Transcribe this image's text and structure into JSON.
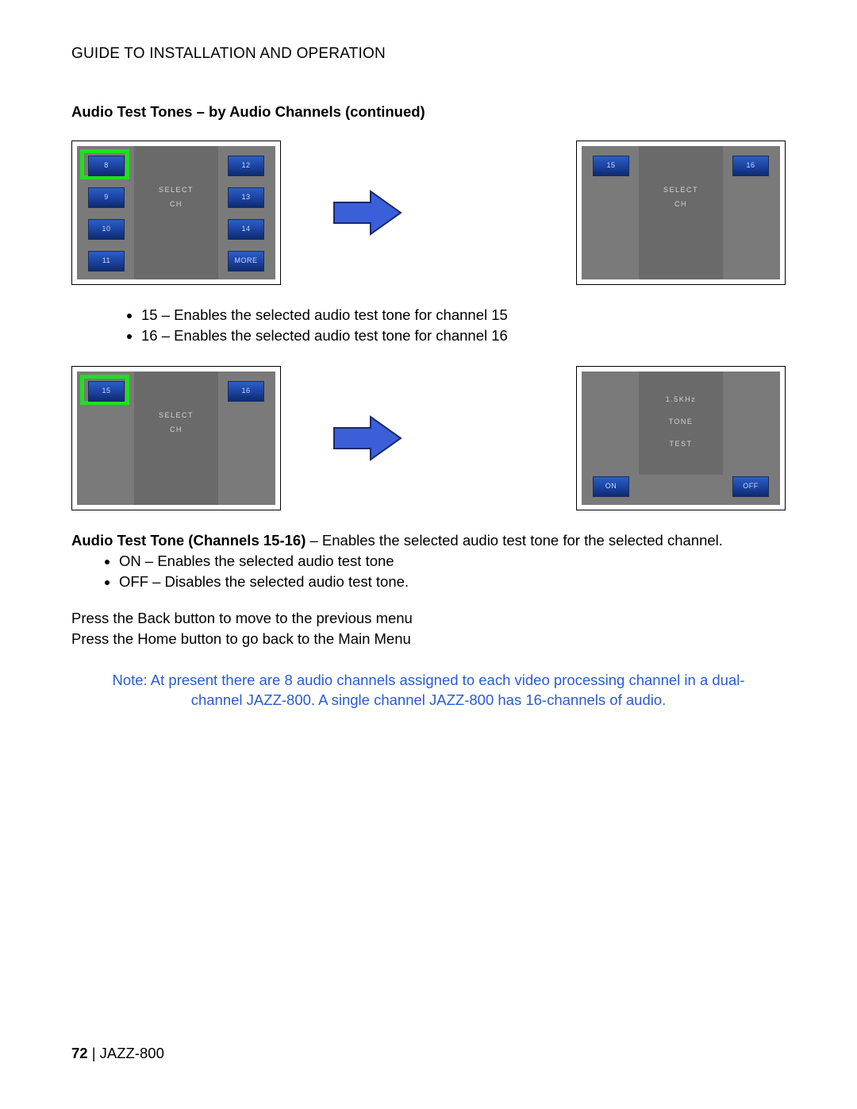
{
  "header": "GUIDE TO INSTALLATION AND OPERATION",
  "section_heading": "Audio Test Tones – by Audio Channels (continued)",
  "panel1": {
    "select": "SELECT",
    "ch": "CH",
    "b8": "8",
    "b9": "9",
    "b10": "10",
    "b11": "11",
    "b12": "12",
    "b13": "13",
    "b14": "14",
    "more": "MORE"
  },
  "panel2": {
    "select": "SELECT",
    "ch": "CH",
    "b15": "15",
    "b16": "16"
  },
  "bullets_a": {
    "i1": "15 – Enables the selected audio test tone for channel 15",
    "i2": "16 – Enables the selected audio test tone for channel 16"
  },
  "panel3": {
    "select": "SELECT",
    "ch": "CH",
    "b15": "15",
    "b16": "16"
  },
  "panel4": {
    "l1": "1.5KHz",
    "l2": "TONE",
    "l3": "TEST",
    "on": "ON",
    "off": "OFF"
  },
  "para1_bold": "Audio Test Tone (Channels 15-16)",
  "para1_rest": " – Enables the selected audio test tone for the selected channel.",
  "bullets_b": {
    "i1": "ON – Enables the selected audio test tone",
    "i2": "OFF – Disables the selected audio test tone."
  },
  "nav1": "Press the Back button to move to the previous menu",
  "nav2": "Press the Home button to go back to the Main Menu",
  "note": "Note: At present there are 8 audio channels assigned to each video processing channel in a dual-channel JAZZ-800. A single channel JAZZ-800 has 16-channels of audio.",
  "footer_page": "72",
  "footer_sep": "  |  ",
  "footer_model": "JAZZ-800"
}
